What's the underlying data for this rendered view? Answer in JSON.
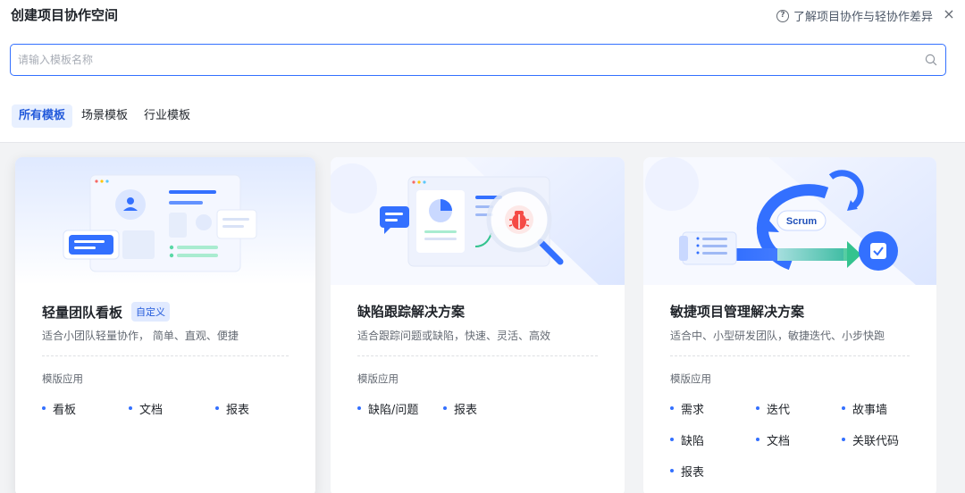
{
  "header": {
    "title": "创建项目协作空间",
    "help_text": "了解项目协作与轻协作差异",
    "help_icon": "?",
    "close_icon": "×"
  },
  "search": {
    "placeholder": "请输入模板名称",
    "value": ""
  },
  "tabs": [
    {
      "label": "所有模板",
      "active": true
    },
    {
      "label": "场景模板",
      "active": false
    },
    {
      "label": "行业模板",
      "active": false
    }
  ],
  "cards": [
    {
      "title": "轻量团队看板",
      "tag": "自定义",
      "desc": "适合小团队轻量协作， 简单、直观、便捷",
      "apps_label": "模版应用",
      "apps": [
        "看板",
        "文档",
        "报表"
      ]
    },
    {
      "title": "缺陷跟踪解决方案",
      "desc": "适合跟踪问题或缺陷，快速、灵活、高效",
      "apps_label": "模版应用",
      "apps": [
        "缺陷/问题",
        "报表"
      ]
    },
    {
      "title": "敏捷项目管理解决方案",
      "desc": "适合中、小型研发团队，敏捷迭代、小步快跑",
      "apps_label": "模版应用",
      "apps": [
        "需求",
        "迭代",
        "故事墙",
        "缺陷",
        "文档",
        "关联代码",
        "报表"
      ],
      "illus_text": "Scrum"
    }
  ],
  "colors": {
    "accent": "#3370ff",
    "tab_active_bg": "#e8f0ff",
    "content_bg": "#f2f3f5"
  }
}
